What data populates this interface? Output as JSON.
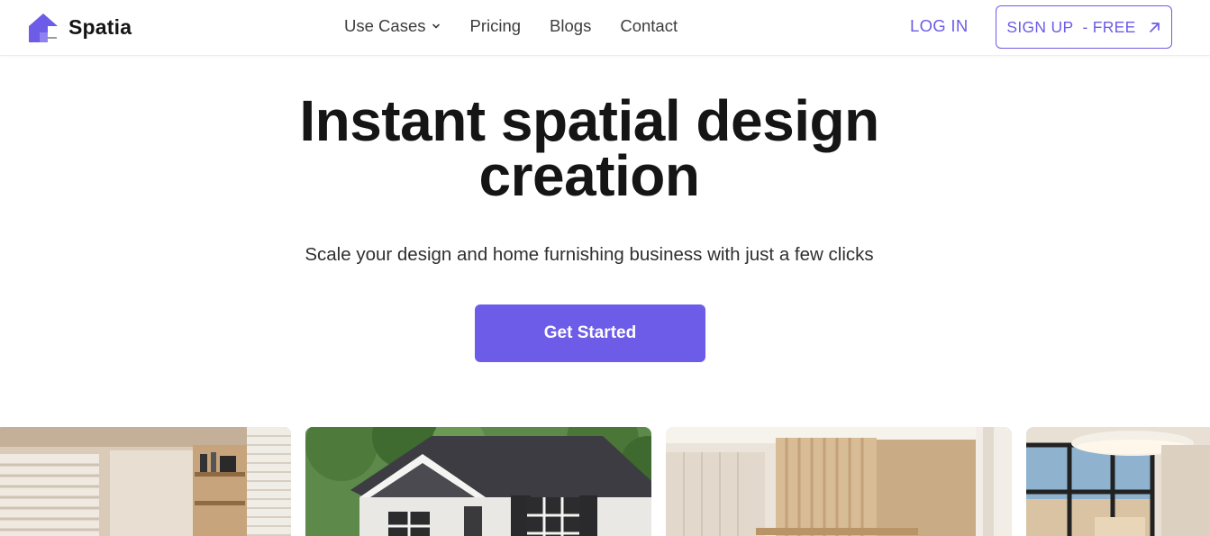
{
  "brand": {
    "name": "Spatia",
    "accent": "#6c5ce7"
  },
  "nav": {
    "items": [
      {
        "label": "Use Cases",
        "has_dropdown": true
      },
      {
        "label": "Pricing"
      },
      {
        "label": "Blogs"
      },
      {
        "label": "Contact"
      }
    ]
  },
  "auth": {
    "login_label": "LOG IN",
    "signup_label": "SIGN UP  - FREE",
    "signup_icon": "arrow-up-right-icon"
  },
  "hero": {
    "title_line1": "Instant spatial design",
    "title_line2": "creation",
    "subtitle": "Scale your design and home furnishing business with just a few clicks",
    "cta_label": "Get Started"
  },
  "gallery": [
    {
      "subject": "interior-room-shelves"
    },
    {
      "subject": "house-exterior"
    },
    {
      "subject": "interior-wood-panel"
    },
    {
      "subject": "interior-window-lamp"
    }
  ]
}
